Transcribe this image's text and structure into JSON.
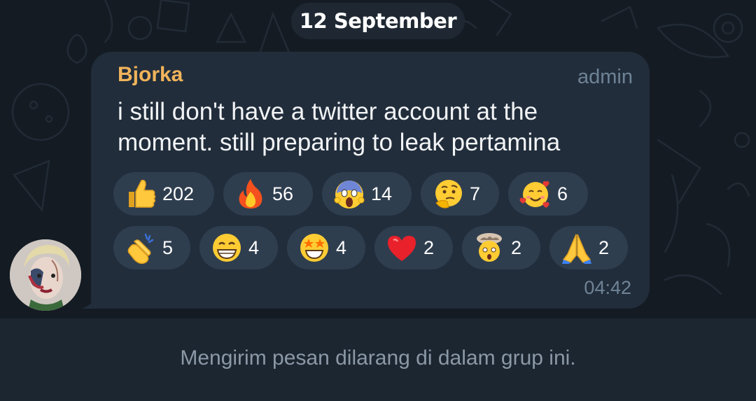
{
  "date_separator": "12 September",
  "message": {
    "sender": "Bjorka",
    "sender_color": "#f1b45b",
    "role": "admin",
    "text": "i still don't have a twitter account at the moment. still preparing to leak pertamina",
    "time": "04:42",
    "reactions": [
      [
        {
          "emoji": "thumbs-up",
          "count": "202"
        },
        {
          "emoji": "fire",
          "count": "56"
        },
        {
          "emoji": "face-screaming-in-fear",
          "count": "14"
        },
        {
          "emoji": "thinking-face",
          "count": "7"
        },
        {
          "emoji": "smiling-face-with-hearts",
          "count": "6"
        }
      ],
      [
        {
          "emoji": "clapping-hands",
          "count": "5"
        },
        {
          "emoji": "beaming-face",
          "count": "4"
        },
        {
          "emoji": "star-struck",
          "count": "4"
        },
        {
          "emoji": "red-heart",
          "count": "2"
        },
        {
          "emoji": "exploding-head",
          "count": "2"
        },
        {
          "emoji": "folded-hands",
          "count": "2"
        }
      ]
    ]
  },
  "footer": {
    "notice": "Mengirim pesan dilarang di dalam grup ini."
  },
  "colors": {
    "background": "#141b23",
    "bubble": "#212d3b",
    "reaction_pill": "#2f3e4f",
    "muted_text": "#6f8396"
  }
}
